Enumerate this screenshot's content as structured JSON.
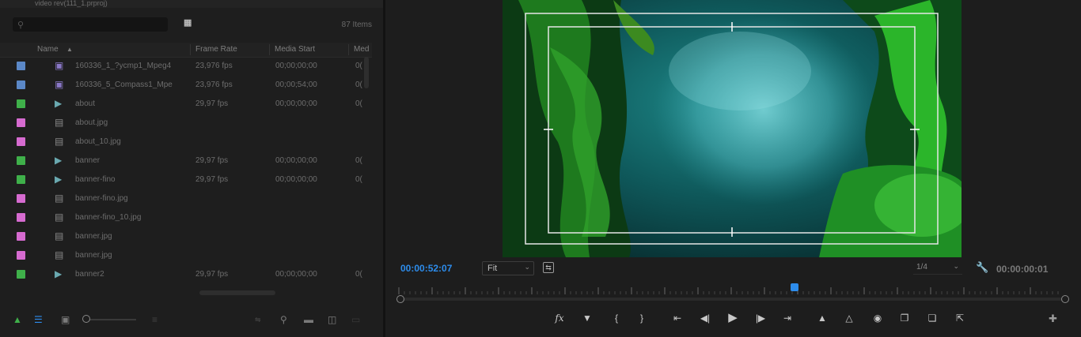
{
  "project_panel": {
    "path": "video rev(111_1.prproj)",
    "item_count": "87 Items",
    "search_placeholder": "",
    "columns": [
      "Name",
      "Frame Rate",
      "Media Start",
      "Med"
    ],
    "rows": [
      {
        "name": "160336_1_?ycmp1_Mpeg4",
        "frame_rate": "23,976 fps",
        "media_start": "00;00;00;00",
        "media_dur": "0(",
        "label_color": "#5b88c7",
        "type": "sequence"
      },
      {
        "name": "160336_5_Compass1_Mpe",
        "frame_rate": "23,976 fps",
        "media_start": "00;00;54;00",
        "media_dur": "0(",
        "label_color": "#5b88c7",
        "type": "sequence"
      },
      {
        "name": "about",
        "frame_rate": "29,97 fps",
        "media_start": "00;00;00;00",
        "media_dur": "0(",
        "label_color": "#3fb04a",
        "type": "video"
      },
      {
        "name": "about.jpg",
        "frame_rate": "",
        "media_start": "",
        "media_dur": "",
        "label_color": "#d66bd0",
        "type": "image"
      },
      {
        "name": "about_10.jpg",
        "frame_rate": "",
        "media_start": "",
        "media_dur": "",
        "label_color": "#d66bd0",
        "type": "image"
      },
      {
        "name": "banner",
        "frame_rate": "29,97 fps",
        "media_start": "00;00;00;00",
        "media_dur": "0(",
        "label_color": "#3fb04a",
        "type": "video"
      },
      {
        "name": "banner-fino",
        "frame_rate": "29,97 fps",
        "media_start": "00;00;00;00",
        "media_dur": "0(",
        "label_color": "#3fb04a",
        "type": "video"
      },
      {
        "name": "banner-fino.jpg",
        "frame_rate": "",
        "media_start": "",
        "media_dur": "",
        "label_color": "#d66bd0",
        "type": "image"
      },
      {
        "name": "banner-fino_10.jpg",
        "frame_rate": "",
        "media_start": "",
        "media_dur": "",
        "label_color": "#d66bd0",
        "type": "image"
      },
      {
        "name": "banner.jpg",
        "frame_rate": "",
        "media_start": "",
        "media_dur": "",
        "label_color": "#d66bd0",
        "type": "image"
      },
      {
        "name": "banner.jpg",
        "frame_rate": "",
        "media_start": "",
        "media_dur": "",
        "label_color": "#d66bd0",
        "type": "image"
      },
      {
        "name": "banner2",
        "frame_rate": "29,97 fps",
        "media_start": "00;00;00;00",
        "media_dur": "0(",
        "label_color": "#3fb04a",
        "type": "video"
      }
    ]
  },
  "program_monitor": {
    "timecode": "00:00:52:07",
    "zoom": "Fit",
    "resolution": "1/4",
    "duration": "00:00:00:01",
    "transport_icons": [
      "fx-icon",
      "marker-icon",
      "mark-in-icon",
      "mark-out-icon",
      "go-to-in-icon",
      "step-back-icon",
      "play-icon",
      "step-forward-icon",
      "go-to-out-icon",
      "lift-icon",
      "extract-icon",
      "export-frame-icon",
      "insert-icon",
      "overwrite-icon",
      "export-icon"
    ]
  },
  "colors": {
    "accent": "#2d8ceb",
    "label_blue": "#5b88c7",
    "label_green": "#3fb04a",
    "label_pink": "#d66bd0"
  }
}
